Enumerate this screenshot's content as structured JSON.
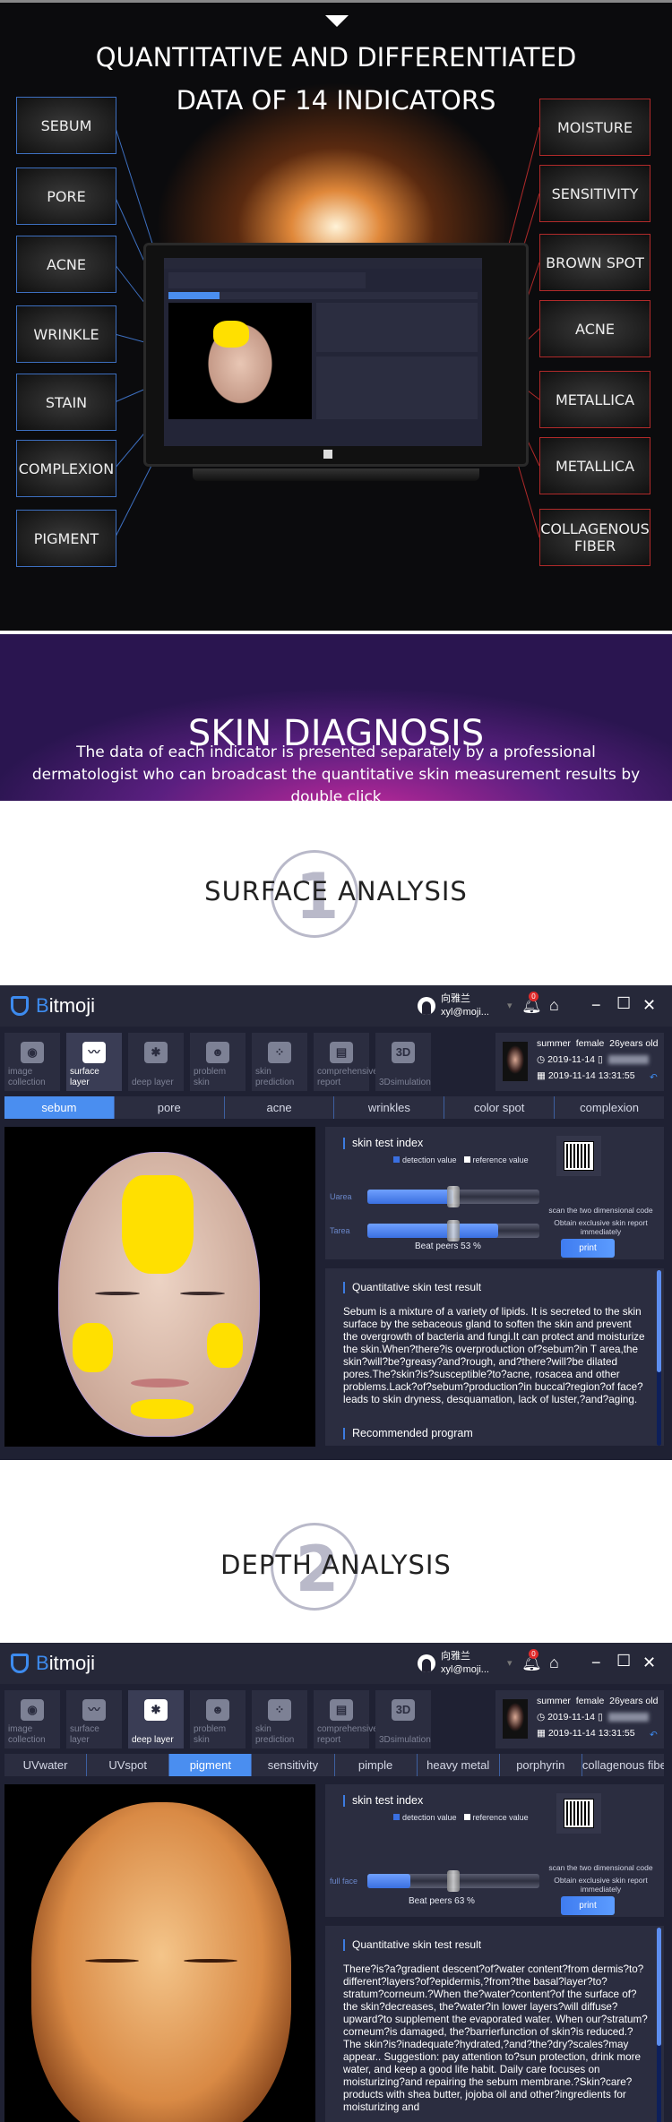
{
  "hero": {
    "title_line1": "QUANTITATIVE AND DIFFERENTIATED",
    "title_line2": "DATA OF 14 INDICATORS",
    "left_indicators": [
      "SEBUM",
      "PORE",
      "ACNE",
      "WRINKLE",
      "STAIN",
      "COMPLEXION",
      "PIGMENT"
    ],
    "right_indicators": [
      "MOISTURE",
      "SENSITIVITY",
      "BROWN SPOT",
      "ACNE",
      "METALLICA",
      "METALLICA",
      "COLLAGENOUS FIBER"
    ]
  },
  "banner": {
    "title": "SKIN DIAGNOSIS",
    "text": "The data of each indicator is presented separately by a professional dermatologist who can broadcast the quantitative skin measurement results by double click"
  },
  "sections": [
    {
      "number": "1",
      "title": "SURFACE ANALYSIS"
    },
    {
      "number": "2",
      "title": "DEPTH ANALYSIS"
    }
  ],
  "app": {
    "logo_prefix": "B",
    "logo_rest": "itmoji",
    "user_name": "向雅兰",
    "user_email": "xyl@moji...",
    "notification_count": "0",
    "toolbar": [
      "image collection",
      "surface layer",
      "deep layer",
      "problem skin",
      "skin prediction",
      "comprehensive report",
      "3Dsimulation"
    ],
    "toolbar_icons": [
      "camera-icon",
      "chart-monitor-icon",
      "molecule-icon",
      "mask-icon",
      "bubbles-icon",
      "clipboard-chart-icon",
      "3d-icon"
    ],
    "profile": {
      "name": "summer",
      "gender": "female",
      "age": "26years old",
      "date": "2019-11-14",
      "datetime": "2019-11-14 13:31:55"
    },
    "accent": "#4a8ef0",
    "skin_index_title": "skin test index",
    "legend_detection": "detection value",
    "legend_reference": "reference value",
    "qr_text": "scan the two dimensional code",
    "qr_sub": "Obtain exclusive skin report immediately",
    "print": "print",
    "result_title": "Quantitative skin test result",
    "recommended": "Recommended program"
  },
  "surface": {
    "tabs": [
      "sebum",
      "pore",
      "acne",
      "wrinkles",
      "color spot",
      "complexion"
    ],
    "active_tab": 0,
    "active_tool": 1,
    "sliders": [
      {
        "label": "Uarea",
        "detection": 0.5,
        "reference": 0.5
      },
      {
        "label": "Tarea",
        "detection": 0.76,
        "reference": 0.5
      }
    ],
    "beat": "Beat peers  53 %",
    "result_text": "Sebum is a mixture of a variety of lipids. It is secreted to the skin surface by the sebaceous gland to soften the skin and prevent the overgrowth of bacteria and fungi.It can protect and moisturize the skin.When?there?is overproduction of?sebum?in T area,the skin?will?be?greasy?and?rough, and?there?will?be dilated pores.The?skin?is?susceptible?to?acne, rosacea and other problems.Lack?of?sebum?production?in buccal?region?of face?leads to skin dryness, desquamation, lack of luster,?and?aging."
  },
  "depth": {
    "tabs": [
      "UVwater",
      "UVspot",
      "pigment",
      "sensitivity",
      "pimple",
      "heavy metal",
      "porphyrin",
      "collagenous fibe"
    ],
    "active_tab": 2,
    "active_tool": 2,
    "sliders": [
      {
        "label": "full face",
        "detection": 0.25,
        "reference": 0.5
      }
    ],
    "beat": "Beat peers  63 %",
    "result_text": "There?is?a?gradient descent?of?water content?from dermis?to?different?layers?of?epidermis,?from?the basal?layer?to?stratum?corneum.?When the?water?content?of the surface of?the skin?decreases, the?water?in lower layers?will diffuse?upward?to supplement the evaporated water. When our?stratum?corneum?is damaged, the?barrierfunction of skin?is reduced.?The skin?is?inadequate?hydrated,?and?the?dry?scales?may appear.. Suggestion: pay attention to?sun protection, drink more water, and keep a good life habit. Daily care focuses on moisturizing?and repairing the sebum membrane.?Skin?care?products with shea butter, jojoba oil and other?ingredients for moisturizing and"
  }
}
